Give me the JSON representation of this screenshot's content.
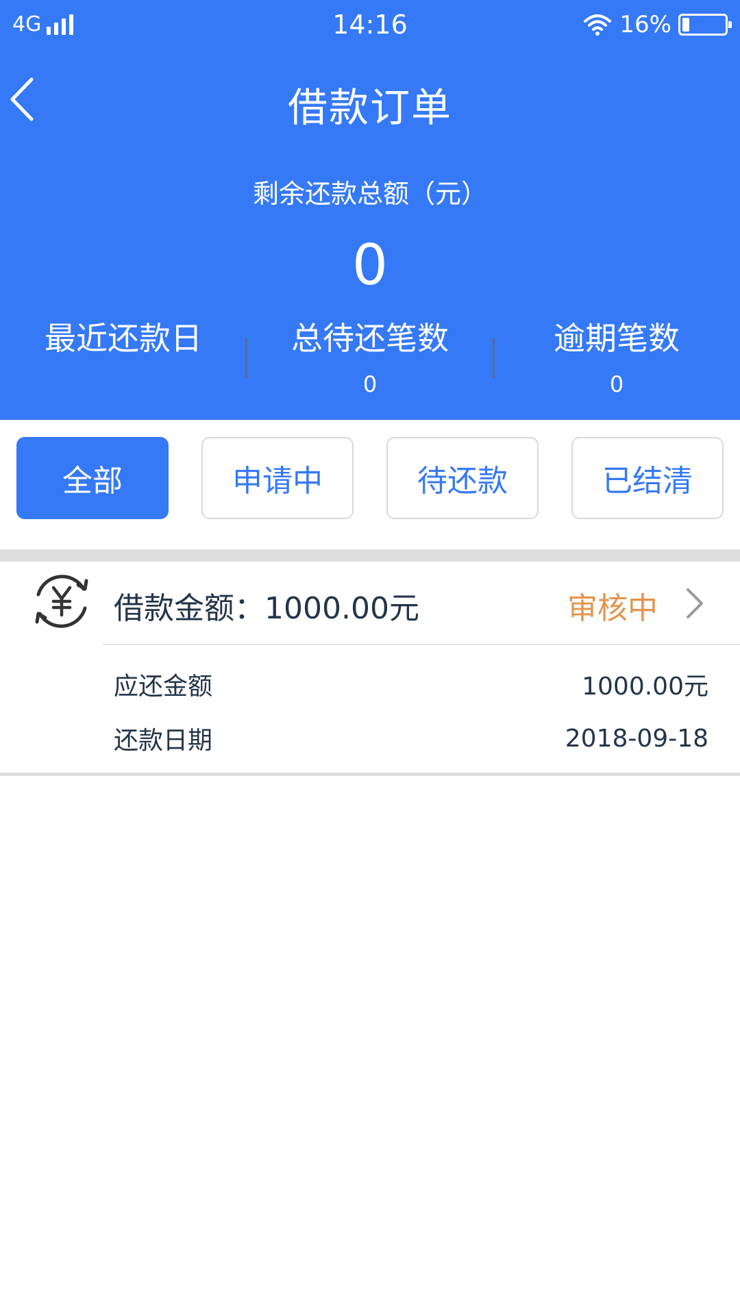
{
  "status_bar": {
    "network": "4G",
    "time": "14:16",
    "battery_percent": "16%"
  },
  "nav": {
    "title": "借款订单",
    "back_icon": "chevron-left-icon"
  },
  "summary": {
    "total_label": "剩余还款总额（元）",
    "total_value": "0",
    "stats": [
      {
        "label": "最近还款日",
        "value": ""
      },
      {
        "label": "总待还笔数",
        "value": "0"
      },
      {
        "label": "逾期笔数",
        "value": "0"
      }
    ]
  },
  "tabs": [
    {
      "label": "全部",
      "active": true
    },
    {
      "label": "申请中",
      "active": false
    },
    {
      "label": "待还款",
      "active": false
    },
    {
      "label": "已结清",
      "active": false
    }
  ],
  "orders": [
    {
      "icon": "yuan-refresh-icon",
      "title": "借款金额：1000.00元",
      "status": "审核中",
      "rows": [
        {
          "label": "应还金额",
          "value": "1000.00元"
        },
        {
          "label": "还款日期",
          "value": "2018-09-18"
        }
      ]
    }
  ],
  "colors": {
    "primary": "#3579f6",
    "status_pending": "#e4944d",
    "text_dark": "#233548"
  }
}
